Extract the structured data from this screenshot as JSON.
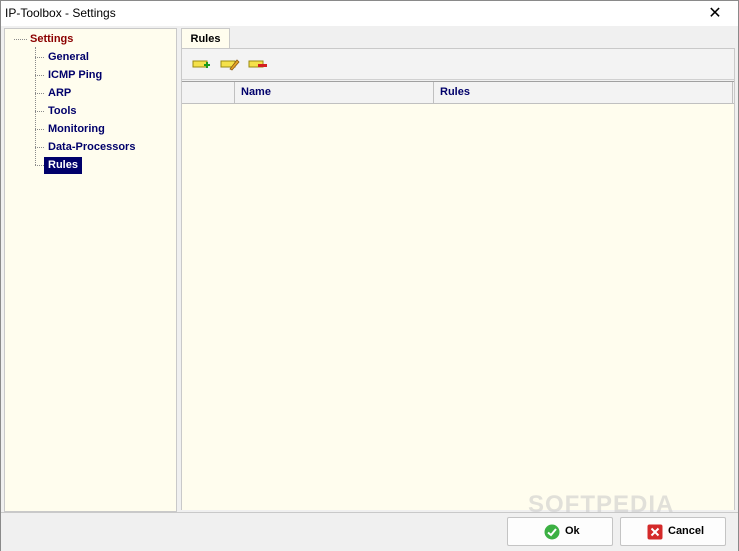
{
  "window": {
    "title": "IP-Toolbox - Settings",
    "close_label": "✕"
  },
  "tree": {
    "root": "Settings",
    "items": [
      "General",
      "ICMP Ping",
      "ARP",
      "Tools",
      "Monitoring",
      "Data-Processors",
      "Rules"
    ],
    "selected": "Rules"
  },
  "tabs": [
    {
      "label": "Rules"
    }
  ],
  "toolbar": {
    "icons": [
      "add-rule-icon",
      "edit-rule-icon",
      "delete-rule-icon"
    ]
  },
  "grid": {
    "columns": [
      "",
      "Name",
      "Rules"
    ],
    "rows": []
  },
  "buttons": {
    "ok": "Ok",
    "cancel": "Cancel"
  },
  "watermark": "SOFTPEDIA",
  "colors": {
    "tree_bg": "#fffdee",
    "selection": "#00006a",
    "root_text": "#8b0000"
  }
}
